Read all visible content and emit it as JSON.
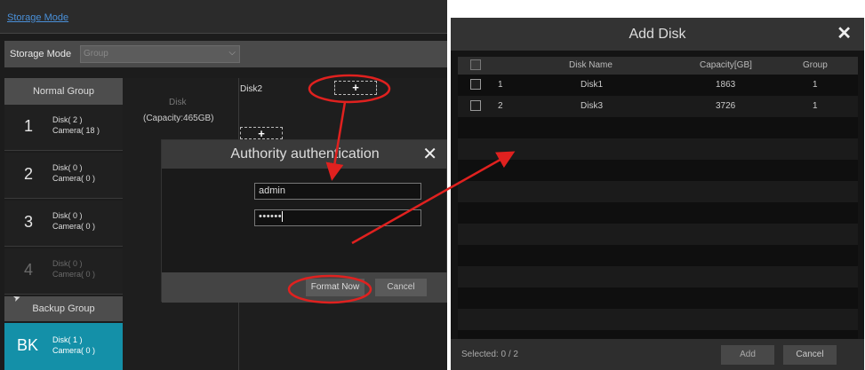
{
  "left": {
    "top_link": "Storage Mode",
    "storage_mode_label": "Storage Mode",
    "storage_mode_value": "Group",
    "normal_group_header": "Normal Group",
    "groups": [
      {
        "num": "1",
        "disk": "Disk( 2 )",
        "camera": "Camera( 18 )"
      },
      {
        "num": "2",
        "disk": "Disk( 0 )",
        "camera": "Camera( 0 )"
      },
      {
        "num": "3",
        "disk": "Disk( 0 )",
        "camera": "Camera( 0 )"
      },
      {
        "num": "4",
        "disk": "Disk( 0 )",
        "camera": "Camera( 0 )"
      }
    ],
    "backup_group_header": "Backup Group",
    "backup": {
      "num": "BK",
      "disk": "Disk( 1 )",
      "camera": "Camera( 0 )"
    },
    "disk_label": "Disk",
    "disk_capacity": "(Capacity:465GB)",
    "disk2_label": "Disk2",
    "plus": "+"
  },
  "auth_dialog": {
    "title": "Authority authentication",
    "username": "admin",
    "password_mask": "••••••",
    "format_button": "Format Now",
    "cancel_button": "Cancel"
  },
  "add_disk": {
    "title": "Add Disk",
    "columns": [
      "Disk Name",
      "Capacity[GB]",
      "Group"
    ],
    "rows": [
      {
        "idx": "1",
        "name": "Disk1",
        "capacity": "1863",
        "group": "1"
      },
      {
        "idx": "2",
        "name": "Disk3",
        "capacity": "3726",
        "group": "1"
      }
    ],
    "selected_text": "Selected: 0 / 2",
    "add_button": "Add",
    "cancel_button": "Cancel"
  },
  "colors": {
    "accent_teal": "#1490a8",
    "annotation_red": "#e0211f",
    "link_blue": "#4a90d9"
  },
  "icons": {
    "close": "close-icon",
    "dropdown": "chevron-down-icon",
    "cursor": "mouse-cursor-icon"
  }
}
